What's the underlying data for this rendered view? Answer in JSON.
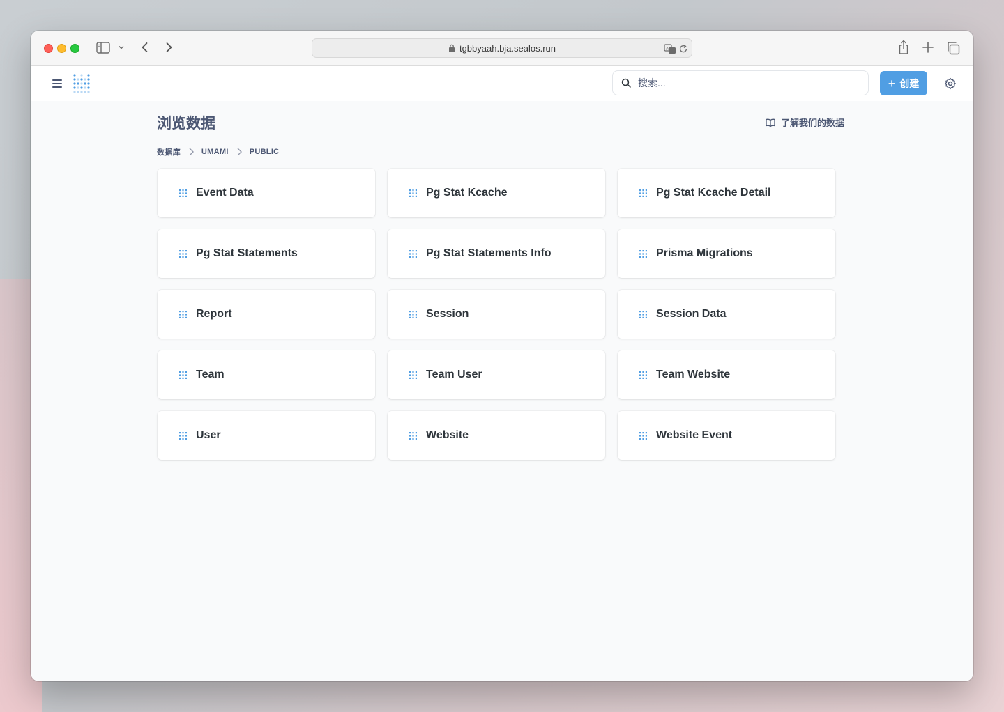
{
  "browser": {
    "url": "tgbbyaah.bja.sealos.run"
  },
  "header": {
    "search_placeholder": "搜索...",
    "create_label": "创建"
  },
  "page": {
    "title": "浏览数据",
    "learn_link": "了解我们的数据"
  },
  "breadcrumb": [
    "数据库",
    "UMAMI",
    "PUBLIC"
  ],
  "tables": [
    "Event Data",
    "Pg Stat Kcache",
    "Pg Stat Kcache Detail",
    "Pg Stat Statements",
    "Pg Stat Statements Info",
    "Prisma Migrations",
    "Report",
    "Session",
    "Session Data",
    "Team",
    "Team User",
    "Team Website",
    "User",
    "Website",
    "Website Event"
  ],
  "colors": {
    "accent": "#509ee3",
    "text": "#4c5773",
    "card_text": "#2e353b"
  }
}
